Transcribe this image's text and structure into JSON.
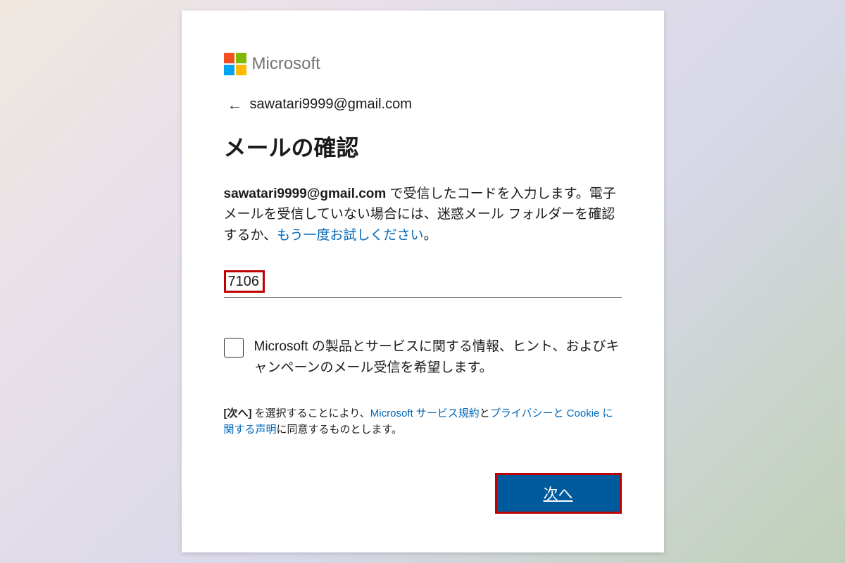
{
  "brand": {
    "name": "Microsoft"
  },
  "account": {
    "email": "sawatari9999@gmail.com"
  },
  "title": "メールの確認",
  "instruction": {
    "email_bold": "sawatari9999@gmail.com",
    "part1": " で受信したコードを入力します。電子メールを受信していない場合には、迷惑メール フォルダーを確認するか、",
    "retry_link": "もう一度お試しください",
    "part2": "。"
  },
  "code": {
    "value": "7106"
  },
  "optin": {
    "label": "Microsoft の製品とサービスに関する情報、ヒント、およびキャンペーンのメール受信を希望します。"
  },
  "legal": {
    "p1a": "[次へ]",
    "p1b": " を選択することにより、",
    "tos_link": "Microsoft サービス規約",
    "p2": "と",
    "privacy_link": "プライバシーと Cookie に関する声明",
    "p3": "に同意するものとします。"
  },
  "buttons": {
    "next": "次へ"
  }
}
